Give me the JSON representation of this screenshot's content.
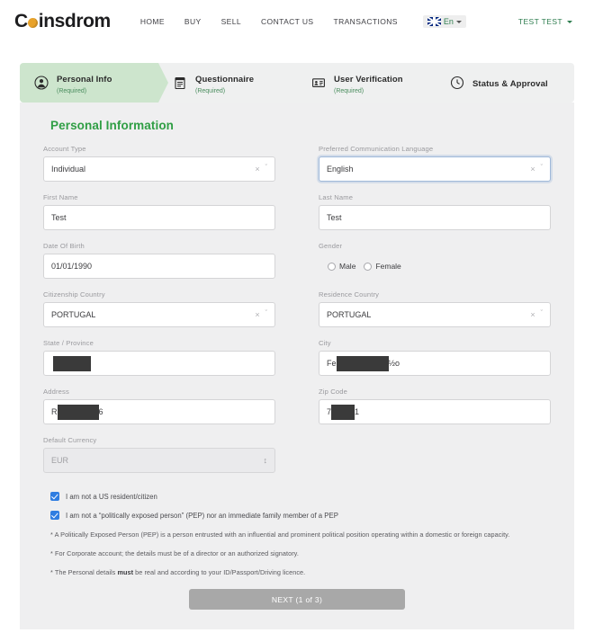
{
  "navbar": {
    "logo": {
      "pre": "C",
      "post": "insdrom",
      "icon": "coin-icon"
    },
    "links": [
      "HOME",
      "BUY",
      "SELL",
      "CONTACT US",
      "TRANSACTIONS"
    ],
    "language": {
      "label": "En",
      "flag_icon": "uk-flag-icon",
      "caret_icon": "chevron-down-icon"
    },
    "user": {
      "name": "TEST TEST",
      "caret_icon": "chevron-down-icon"
    }
  },
  "steps": [
    {
      "title": "Personal Info",
      "sub": "(Required)",
      "icon": "person-circle-icon",
      "active": true
    },
    {
      "title": "Questionnaire",
      "sub": "(Required)",
      "icon": "clipboard-icon",
      "active": false
    },
    {
      "title": "User Verification",
      "sub": "(Required)",
      "icon": "id-card-icon",
      "active": false
    },
    {
      "title": "Status & Approval",
      "sub": "",
      "icon": "clock-icon",
      "active": false
    }
  ],
  "form": {
    "title": "Personal Information",
    "account_type": {
      "label": "Account Type",
      "value": "Individual",
      "clear": "×",
      "caret": "ˇ"
    },
    "language": {
      "label": "Preferred Communication Language",
      "value": "English",
      "clear": "×",
      "caret": "ˇ"
    },
    "first_name": {
      "label": "First Name",
      "value": "Test"
    },
    "last_name": {
      "label": "Last Name",
      "value": "Test"
    },
    "dob": {
      "label": "Date Of Birth",
      "value": "01/01/1990"
    },
    "gender": {
      "label": "Gender",
      "options": [
        "Male",
        "Female"
      ],
      "selected": ""
    },
    "citizenship": {
      "label": "Citizenship Country",
      "value": "PORTUGAL",
      "clear": "×",
      "caret": "ˇ"
    },
    "residence": {
      "label": "Residence Country",
      "value": "PORTUGAL",
      "clear": "×",
      "caret": "ˇ"
    },
    "state": {
      "label": "State / Province",
      "value": "",
      "redacted": true
    },
    "city": {
      "label": "City",
      "prefix": "Fe",
      "suffix": "½o",
      "redacted": true
    },
    "address": {
      "label": "Address",
      "prefix": "R",
      "suffix": "6",
      "redacted": true
    },
    "zip": {
      "label": "Zip Code",
      "prefix": "7",
      "suffix": "1",
      "redacted": true
    },
    "currency": {
      "label": "Default Currency",
      "value": "EUR",
      "disabled": true,
      "spinner": "↕"
    },
    "checkboxes": [
      "I am not a US resident/citizen",
      "I am not a “politically exposed person” (PEP) nor an immediate family member of a PEP"
    ],
    "notes": [
      "* A Politically Exposed Person (PEP) is a person entrusted with an influential and prominent political position operating within a domestic or foreign capacity.",
      "* For Corporate account; the details must be of a director or an authorized signatory."
    ],
    "note_rich": {
      "pre": "* The Personal details ",
      "bold": "must",
      "post": " be real and according to your ID/Passport/Driving licence."
    },
    "next_button": "NEXT (1 of 3)"
  },
  "colors": {
    "brand_green": "#2f9e44",
    "step_active_bg": "#cde5cd",
    "card_bg": "#efeff0",
    "checkbox_blue": "#2f7de1",
    "button_gray": "#a8a8a8",
    "coin_gold": "#e8a22a"
  }
}
